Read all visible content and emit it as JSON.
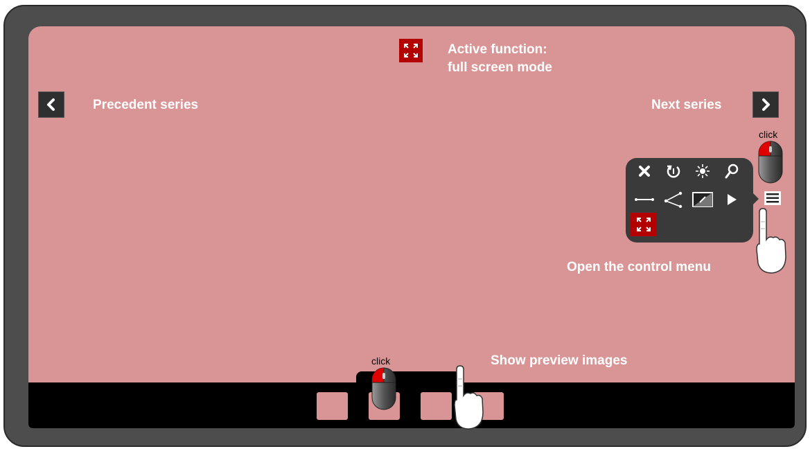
{
  "labels": {
    "active_function_line1": "Active function:",
    "active_function_line2": "full screen mode",
    "precedent_series": "Precedent series",
    "next_series": "Next series",
    "open_control_menu": "Open the control menu",
    "show_preview_images": "Show preview images",
    "click_top": "click",
    "click_bottom": "click"
  },
  "menu": {
    "items": [
      "close-icon",
      "rotate-icon",
      "brightness-icon",
      "zoom-icon",
      "measure-line-icon",
      "angle-icon",
      "contrast-icon",
      "play-icon",
      "fullscreen-icon"
    ],
    "active_item": "fullscreen-icon"
  },
  "preview": {
    "thumbnail_count": 4
  },
  "colors": {
    "screen": "#d99595",
    "accent": "#b30000",
    "frame": "#4d4d4d",
    "panel": "#3a3a3a"
  }
}
